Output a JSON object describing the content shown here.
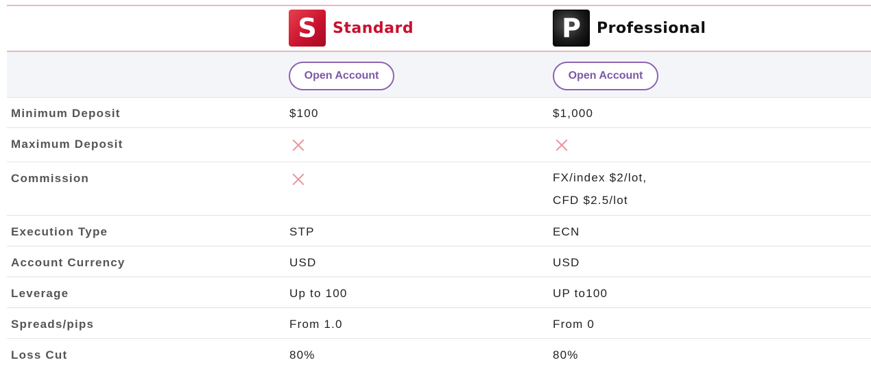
{
  "plans": {
    "standard": {
      "logo_letter": "S",
      "name": "Standard",
      "button": "Open Account"
    },
    "professional": {
      "logo_letter": "P",
      "name": "Professional",
      "button": "Open Account"
    }
  },
  "rows": {
    "min_deposit": {
      "label": "Minimum Deposit",
      "standard": "$100",
      "professional": "$1,000"
    },
    "max_deposit": {
      "label": "Maximum Deposit",
      "standard_icon": "cross-icon",
      "professional_icon": "cross-icon"
    },
    "commission": {
      "label": "Commission",
      "standard_icon": "cross-icon",
      "professional_line1": "FX/index $2/lot,",
      "professional_line2": "CFD $2.5/lot"
    },
    "execution": {
      "label": "Execution Type",
      "standard": "STP",
      "professional": "ECN"
    },
    "currency": {
      "label": "Account Currency",
      "standard": "USD",
      "professional": "USD"
    },
    "leverage": {
      "label": "Leverage",
      "standard": "Up to 100",
      "professional": "UP to100"
    },
    "spreads": {
      "label": "Spreads/pips",
      "standard": "From 1.0",
      "professional": "From 0"
    },
    "losscut": {
      "label": "Loss Cut",
      "standard": "80%",
      "professional": "80%"
    }
  },
  "colors": {
    "accent_purple": "#8b63b0",
    "standard_red": "#c8102e",
    "divider_pink": "#e9b7bf",
    "cross_pink": "#e8939c"
  }
}
